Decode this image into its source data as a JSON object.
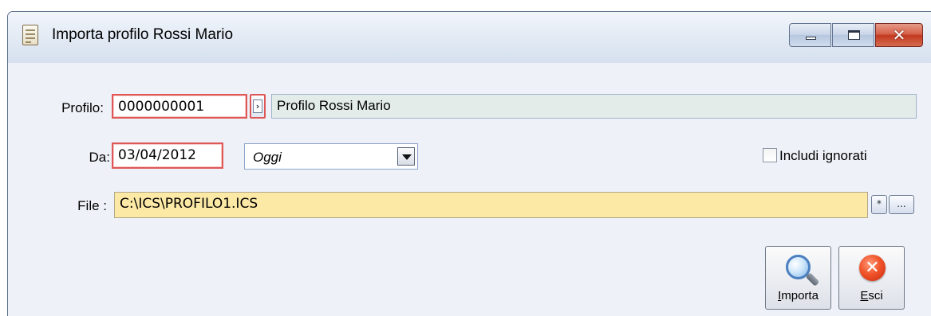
{
  "window": {
    "title": "Importa profilo Rossi Mario",
    "icon": "document-icon",
    "controls": {
      "minimize": "minimize-icon",
      "maximize": "maximize-icon",
      "close": "close-icon"
    }
  },
  "form": {
    "profilo": {
      "label": "Profilo:",
      "code": "0000000001",
      "zoom_glyph": "›",
      "description": "Profilo Rossi Mario"
    },
    "da": {
      "label": "Da:",
      "date": "03/04/2012",
      "combo_value": "Oggi"
    },
    "includi": {
      "label": "Includi ignorati",
      "checked": false
    },
    "file": {
      "label": "File :",
      "path": "C:\\ICS\\PROFILO1.ICS",
      "asterisk_glyph": "*",
      "browse_glyph": "..."
    }
  },
  "buttons": {
    "importa": {
      "accel": "I",
      "rest": "mporta",
      "icon": "magnifier-icon"
    },
    "esci": {
      "accel": "E",
      "rest": "sci",
      "icon": "exit-icon"
    }
  }
}
